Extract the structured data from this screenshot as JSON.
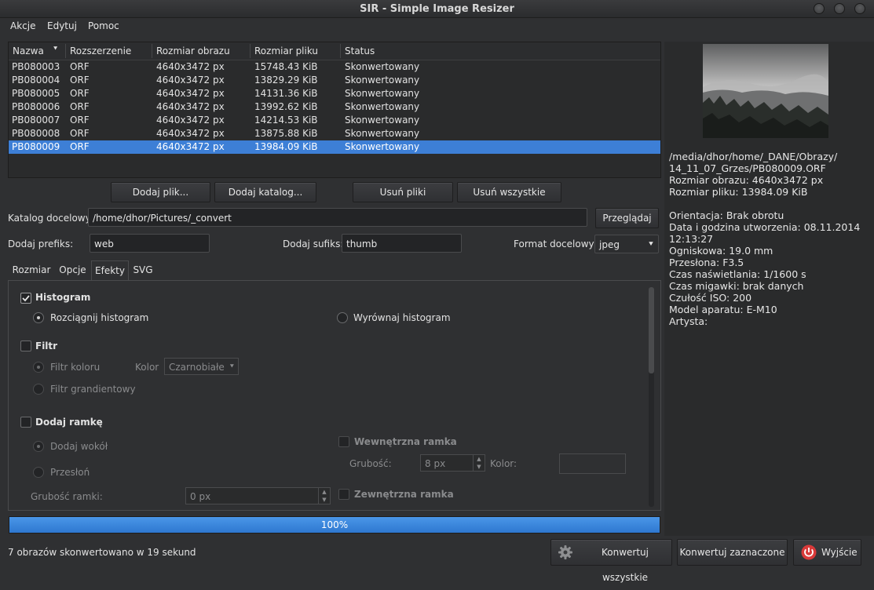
{
  "window": {
    "title": "SIR - Simple Image Resizer"
  },
  "menu": [
    "Akcje",
    "Edytuj",
    "Pomoc"
  ],
  "table": {
    "headers": [
      "Nazwa",
      "Rozszerzenie",
      "Rozmiar obrazu",
      "Rozmiar pliku",
      "Status"
    ],
    "rows": [
      [
        "PB080003",
        "ORF",
        "4640x3472 px",
        "15748.43 KiB",
        "Skonwertowany"
      ],
      [
        "PB080004",
        "ORF",
        "4640x3472 px",
        "13829.29 KiB",
        "Skonwertowany"
      ],
      [
        "PB080005",
        "ORF",
        "4640x3472 px",
        "14131.36 KiB",
        "Skonwertowany"
      ],
      [
        "PB080006",
        "ORF",
        "4640x3472 px",
        "13992.62 KiB",
        "Skonwertowany"
      ],
      [
        "PB080007",
        "ORF",
        "4640x3472 px",
        "14214.53 KiB",
        "Skonwertowany"
      ],
      [
        "PB080008",
        "ORF",
        "4640x3472 px",
        "13875.88 KiB",
        "Skonwertowany"
      ],
      [
        "PB080009",
        "ORF",
        "4640x3472 px",
        "13984.09 KiB",
        "Skonwertowany"
      ]
    ],
    "selected_row": 6
  },
  "file_buttons": {
    "add_file": "Dodaj plik...",
    "add_dir": "Dodaj katalog...",
    "remove_files": "Usuń pliki",
    "remove_all": "Usuń wszystkie"
  },
  "target": {
    "dir_label": "Katalog docelowy:",
    "dir_value": "/home/dhor/Pictures/_convert",
    "browse": "Przeglądaj",
    "prefix_label": "Dodaj prefiks:",
    "prefix_value": "web",
    "suffix_label": "Dodaj sufiks:",
    "suffix_value": "thumb",
    "format_label": "Format docelowy:",
    "format_value": "jpeg"
  },
  "tabs": [
    "Rozmiar",
    "Opcje",
    "Efekty",
    "SVG"
  ],
  "active_tab": "Efekty",
  "effects": {
    "histogram": "Histogram",
    "stretch": "Rozciągnij histogram",
    "equalize": "Wyrównaj histogram",
    "filter": "Filtr",
    "color_filter": "Filtr koloru",
    "color_label": "Kolor",
    "color_value": "Czarnobiałe",
    "gradient_filter": "Filtr grandientowy",
    "add_frame": "Dodaj ramkę",
    "add_around": "Dodaj wokół",
    "overlay": "Przesłoń",
    "frame_thickness_label": "Grubość ramki:",
    "frame_thickness_value": "0 px",
    "inner_frame": "Wewnętrzna ramka",
    "thickness_label": "Grubość:",
    "thickness_value": "8 px",
    "color_label2": "Kolor:",
    "outer_frame": "Zewnętrzna ramka"
  },
  "progress": {
    "value": 1.0,
    "label": "100%"
  },
  "status_text": "7 obrazów skonwertowano w 19 sekund",
  "actions": {
    "convert_all": "Konwertuj wszystkie",
    "convert_selected": "Konwertuj zaznaczone",
    "exit": "Wyjście"
  },
  "info": [
    "/media/dhor/home/_DANE/Obrazy/",
    "14_11_07_Grzes/PB080009.ORF",
    "Rozmiar obrazu: 4640x3472 px",
    "Rozmiar pliku: 13984.09 KiB",
    "",
    "Orientacja: Brak obrotu",
    "Data i godzina utworzenia: 08.11.2014",
    "12:13:27",
    "Ogniskowa: 19.0 mm",
    "Przesłona: F3.5",
    "Czas naświetlania: 1/1600 s",
    "Czas migawki: brak danych",
    "Czułość ISO: 200",
    "Model aparatu: E-M10",
    "Artysta:"
  ],
  "colors": {
    "accent": "#3d7fd6",
    "background": "#2f3032"
  }
}
